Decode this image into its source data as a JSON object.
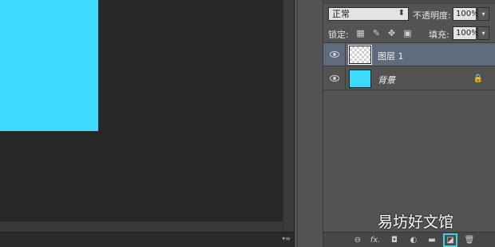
{
  "canvas": {
    "doc_color": "#3ddcff"
  },
  "layers_panel": {
    "blend_mode": "正常",
    "opacity_label": "不透明度:",
    "opacity_value": "100%",
    "lock_label": "锁定:",
    "lock_icons": [
      "lock-transparent-pixels-icon",
      "lock-image-pixels-icon",
      "lock-position-icon",
      "lock-all-icon"
    ],
    "fill_label": "填充:",
    "fill_value": "100%",
    "layers": [
      {
        "name": "图层 1",
        "visible": true,
        "thumbnail": "transparent",
        "selected": true
      },
      {
        "name": "背景",
        "visible": true,
        "thumbnail": "cyan",
        "locked": true,
        "selected": false
      }
    ],
    "footer_icons": [
      "link-layers-icon",
      "fx-icon",
      "add-mask-icon",
      "adjustment-layer-icon",
      "new-group-icon",
      "new-layer-icon",
      "delete-layer-icon"
    ],
    "footer_fx": "fx."
  },
  "watermark": "易坊好文馆"
}
